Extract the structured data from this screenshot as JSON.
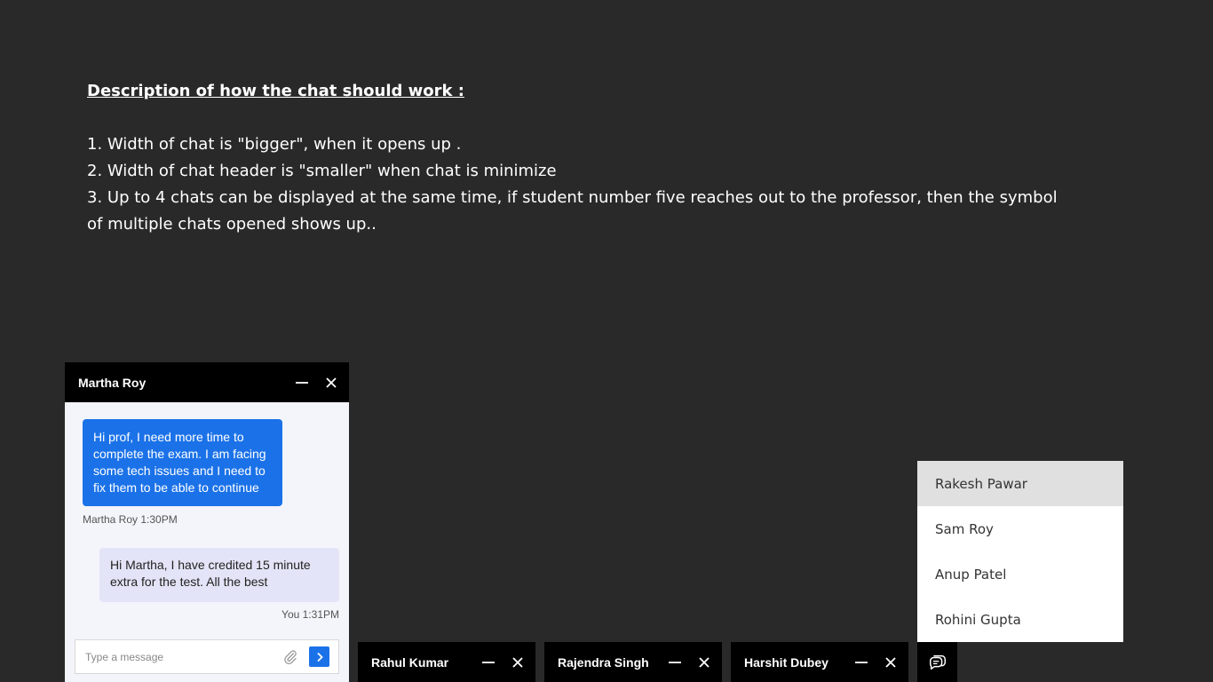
{
  "description": {
    "heading": "Description of how the chat should work :",
    "lines": [
      "1. Width of chat is \"bigger\", when it opens up .",
      "2. Width of chat header is \"smaller\" when chat is minimize",
      "3. Up to 4 chats can be displayed at the same time, if student number five reaches out to the professor, then the symbol of multiple chats opened shows up.."
    ]
  },
  "open_chat": {
    "name": "Martha Roy",
    "messages": [
      {
        "text": "Hi prof, I need more time to complete the exam. I am facing some tech issues and I need to fix them to be able to continue",
        "meta": "Martha Roy 1:30PM"
      },
      {
        "text": "Hi Martha, I have credited 15 minute extra for the test. All the best",
        "meta": "You 1:31PM"
      }
    ],
    "input_placeholder": "Type a message"
  },
  "minimized_chats": [
    {
      "name": "Rahul Kumar"
    },
    {
      "name": "Rajendra Singh"
    },
    {
      "name": "Harshit Dubey"
    }
  ],
  "overflow_chats": [
    {
      "name": "Rakesh Pawar",
      "active": true
    },
    {
      "name": "Sam Roy"
    },
    {
      "name": "Anup Patel"
    },
    {
      "name": "Rohini Gupta"
    }
  ],
  "colors": {
    "background": "#292929",
    "header": "#000000",
    "accent": "#1b72e8",
    "outgoing_bubble": "#e3e4f7"
  }
}
